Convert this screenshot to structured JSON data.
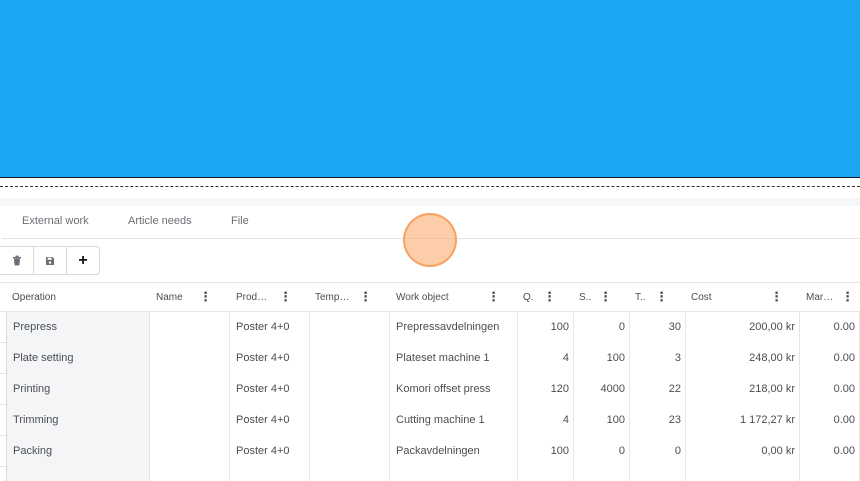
{
  "tabs": [
    {
      "label": "External work"
    },
    {
      "label": "Article needs"
    },
    {
      "label": "File"
    }
  ],
  "toolbar": {
    "delete_icon": "trash-icon",
    "save_icon": "floppy-disk-icon",
    "add_label": "+"
  },
  "columns": [
    {
      "label": "Operation"
    },
    {
      "label": "Name"
    },
    {
      "label": "Prod…"
    },
    {
      "label": "Temp…"
    },
    {
      "label": "Work object"
    },
    {
      "label": "Q."
    },
    {
      "label": "S.."
    },
    {
      "label": "T.."
    },
    {
      "label": "Cost"
    },
    {
      "label": "Mar…"
    }
  ],
  "rows": [
    {
      "operation": "Prepress",
      "name": "",
      "product": "Poster 4+0",
      "template": "",
      "work_object": "Prepressavdelningen",
      "q": "100",
      "s": "0",
      "t": "30",
      "cost": "200,00 kr",
      "margin": "0.00"
    },
    {
      "operation": "Plate setting",
      "name": "",
      "product": "Poster 4+0",
      "template": "",
      "work_object": "Plateset machine 1",
      "q": "4",
      "s": "100",
      "t": "3",
      "cost": "248,00 kr",
      "margin": "0.00"
    },
    {
      "operation": "Printing",
      "name": "",
      "product": "Poster 4+0",
      "template": "",
      "work_object": "Komori offset press",
      "q": "120",
      "s": "4000",
      "t": "22",
      "cost": "218,00 kr",
      "margin": "0.00"
    },
    {
      "operation": "Trimming",
      "name": "",
      "product": "Poster 4+0",
      "template": "",
      "work_object": "Cutting machine 1",
      "q": "4",
      "s": "100",
      "t": "23",
      "cost": "1 172,27 kr",
      "margin": "0.00"
    },
    {
      "operation": "Packing",
      "name": "",
      "product": "Poster 4+0",
      "template": "",
      "work_object": "Packavdelningen",
      "q": "100",
      "s": "0",
      "t": "0",
      "cost": "0,00 kr",
      "margin": "0.00"
    }
  ],
  "colors": {
    "banner": "#1aa6f3",
    "cursor": "#fcb07a"
  }
}
